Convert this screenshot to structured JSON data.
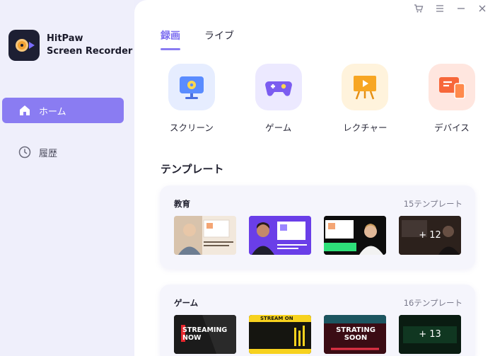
{
  "app": {
    "name_line1": "HitPaw",
    "name_line2": "Screen Recorder"
  },
  "sidebar": {
    "items": [
      {
        "label": "ホーム",
        "icon": "home-icon"
      },
      {
        "label": "履歴",
        "icon": "clock-icon"
      }
    ]
  },
  "window_controls": [
    "cart-icon",
    "menu-icon",
    "minimize-icon",
    "close-icon"
  ],
  "tabs": [
    {
      "label": "録画"
    },
    {
      "label": "ライブ"
    }
  ],
  "modes": [
    {
      "label": "スクリーン",
      "icon": "screen-icon"
    },
    {
      "label": "ゲーム",
      "icon": "gamepad-icon"
    },
    {
      "label": "レクチャー",
      "icon": "lecture-icon"
    },
    {
      "label": "デバイス",
      "icon": "device-icon"
    }
  ],
  "templates": {
    "title": "テンプレート",
    "categories": [
      {
        "name": "教育",
        "count": "15テンプレート",
        "more": "+ 12"
      },
      {
        "name": "ゲーム",
        "count": "16テンプレート",
        "more": "+ 13",
        "thumbs_text": [
          "STREAMING NOW",
          "STREAM ON",
          "STRATING SOON"
        ]
      }
    ]
  },
  "colors": {
    "accent": "#8a7cf2",
    "sidebar_bg": "#efeffb"
  }
}
